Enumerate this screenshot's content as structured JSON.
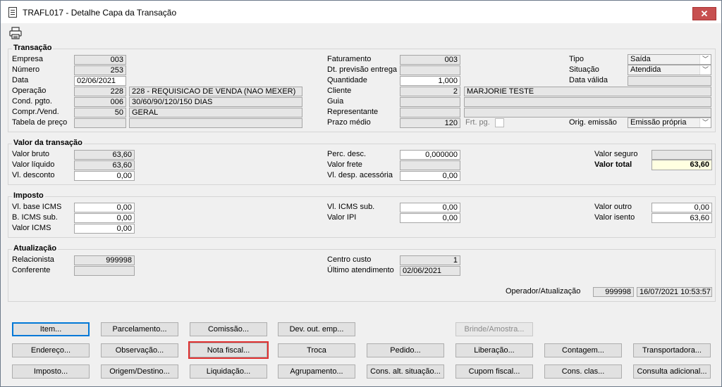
{
  "window": {
    "title": "TRAFL017 - Detalhe Capa da Transação",
    "close_glyph": "✕"
  },
  "transacao": {
    "title": "Transação",
    "empresa": {
      "label": "Empresa",
      "value": "003"
    },
    "numero": {
      "label": "Número",
      "value": "253"
    },
    "data": {
      "label": "Data",
      "value": "02/06/2021"
    },
    "operacao": {
      "label": "Operação",
      "code": "228",
      "desc": "228 - REQUISICAO DE VENDA (NAO MEXER)"
    },
    "cond_pgto": {
      "label": "Cond. pgto.",
      "code": "006",
      "desc": "30/60/90/120/150 DIAS"
    },
    "compr_vend": {
      "label": "Compr./Vend.",
      "code": "50",
      "desc": "GERAL"
    },
    "tabela_preco": {
      "label": "Tabela de preço",
      "code": "",
      "desc": ""
    },
    "faturamento": {
      "label": "Faturamento",
      "value": "003"
    },
    "dt_previsao": {
      "label": "Dt. previsão entrega",
      "value": ""
    },
    "quantidade": {
      "label": "Quantidade",
      "value": "1,000"
    },
    "cliente": {
      "label": "Cliente",
      "code": "2",
      "name": "MARJORIE TESTE"
    },
    "guia": {
      "label": "Guia",
      "value": ""
    },
    "representante": {
      "label": "Representante",
      "value": ""
    },
    "prazo_medio": {
      "label": "Prazo médio",
      "value": "120"
    },
    "frt_pg": {
      "label": "Frt. pg."
    },
    "tipo": {
      "label": "Tipo",
      "value": "Saída"
    },
    "situacao": {
      "label": "Situação",
      "value": "Atendida"
    },
    "data_valida": {
      "label": "Data válida",
      "value": ""
    },
    "orig_emissao": {
      "label": "Orig. emissão",
      "value": "Emissão própria"
    }
  },
  "valor": {
    "title": "Valor da transação",
    "valor_bruto": {
      "label": "Valor bruto",
      "value": "63,60"
    },
    "valor_liquido": {
      "label": "Valor líquido",
      "value": "63,60"
    },
    "vl_desconto": {
      "label": "Vl. desconto",
      "value": "0,00"
    },
    "perc_desc": {
      "label": "Perc. desc.",
      "value": "0,000000"
    },
    "valor_frete": {
      "label": "Valor frete",
      "value": ""
    },
    "vl_desp_acessoria": {
      "label": "Vl. desp. acessória",
      "value": "0,00"
    },
    "valor_seguro": {
      "label": "Valor seguro",
      "value": ""
    },
    "valor_total": {
      "label": "Valor total",
      "value": "63,60"
    }
  },
  "imposto": {
    "title": "Imposto",
    "vl_base_icms": {
      "label": "Vl. base ICMS",
      "value": "0,00"
    },
    "b_icms_sub": {
      "label": "B. ICMS sub.",
      "value": "0,00"
    },
    "valor_icms": {
      "label": "Valor ICMS",
      "value": "0,00"
    },
    "vl_icms_sub": {
      "label": "Vl. ICMS sub.",
      "value": "0,00"
    },
    "valor_ipi": {
      "label": "Valor IPI",
      "value": "0,00"
    },
    "valor_outro": {
      "label": "Valor outro",
      "value": "0,00"
    },
    "valor_isento": {
      "label": "Valor isento",
      "value": "63,60"
    }
  },
  "atualizacao": {
    "title": "Atualização",
    "relacionista": {
      "label": "Relacionista",
      "value": "999998"
    },
    "conferente": {
      "label": "Conferente",
      "value": ""
    },
    "centro_custo": {
      "label": "Centro custo",
      "value": "1"
    },
    "ultimo_atendimento": {
      "label": "Último atendimento",
      "value": "02/06/2021"
    },
    "operador": {
      "label": "Operador/Atualização",
      "code": "999998",
      "datetime": "16/07/2021 10:53:57"
    }
  },
  "buttons": {
    "item": "Item...",
    "parcelamento": "Parcelamento...",
    "comissao": "Comissão...",
    "dev_out_emp": "Dev. out. emp...",
    "brinde_amostra": "Brinde/Amostra...",
    "endereco": "Endereço...",
    "observacao": "Observação...",
    "nota_fiscal": "Nota fiscal...",
    "troca": "Troca",
    "pedido": "Pedido...",
    "liberacao": "Liberação...",
    "contagem": "Contagem...",
    "transportadora": "Transportadora...",
    "imposto": "Imposto...",
    "origem_destino": "Origem/Destino...",
    "liquidacao": "Liquidação...",
    "agrupamento": "Agrupamento...",
    "cons_alt_situacao": "Cons. alt. situação...",
    "cupom_fiscal": "Cupom fiscal...",
    "cons_clas": "Cons. clas...",
    "consulta_adicional": "Consulta adicional..."
  },
  "colors": {
    "highlight_border": "#e03030",
    "total_bg": "#ffffe1",
    "close_bg": "#c75050"
  }
}
